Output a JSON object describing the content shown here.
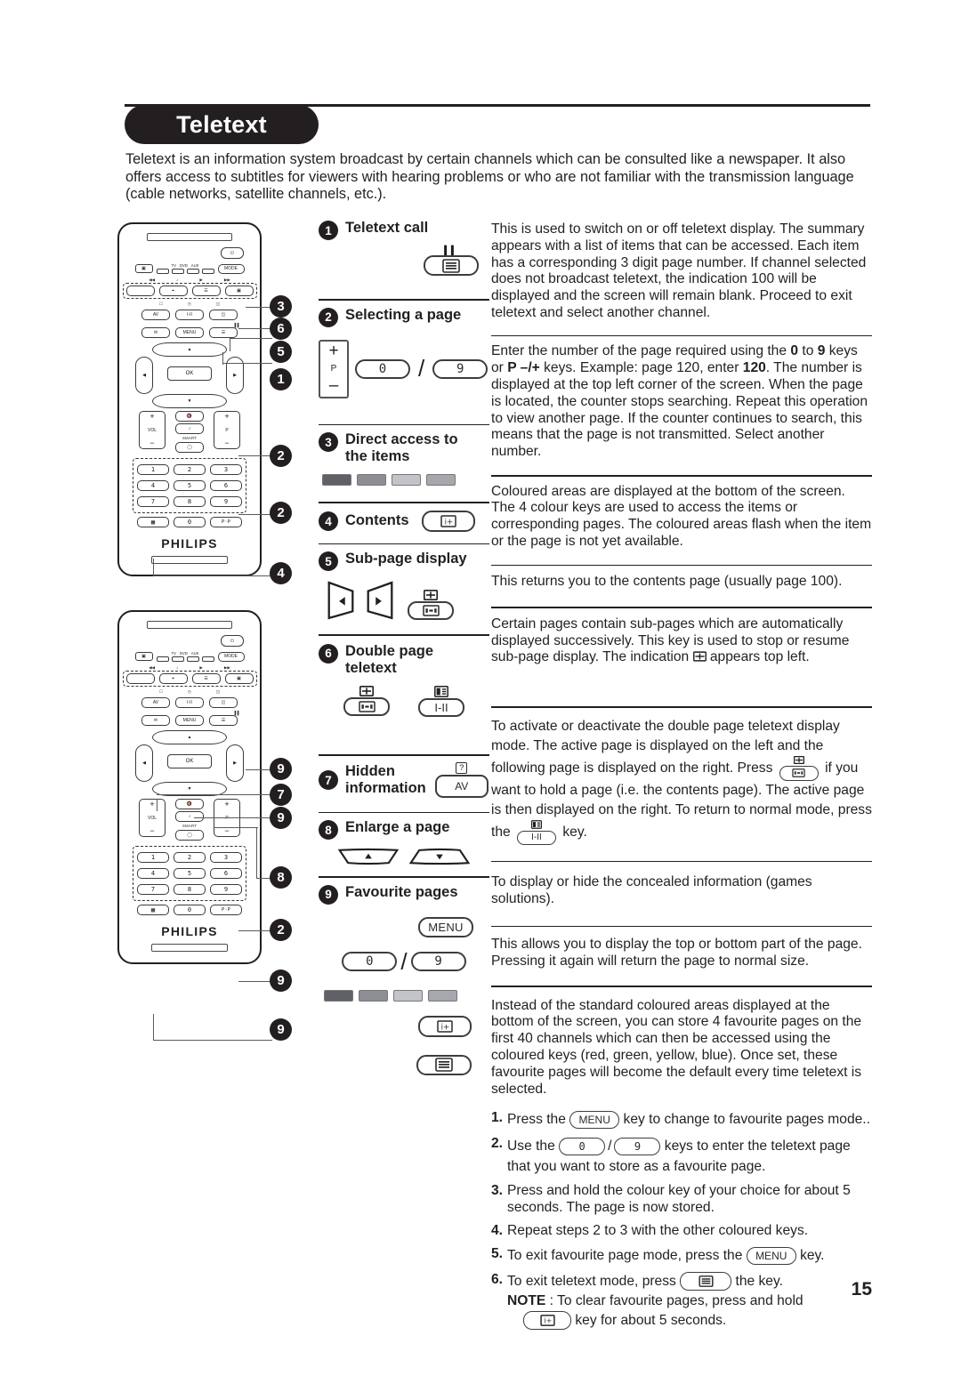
{
  "document": {
    "title": "Teletext",
    "page_number": "15",
    "intro": "Teletext is an information system broadcast by certain channels which can be consulted like a newspaper. It also offers access to subtitles for viewers with hearing problems or who are not familiar with the transmission language (cable networks, satellite channels, etc.)."
  },
  "items": [
    {
      "number": "1",
      "title": "Teletext call",
      "body": "This is used to switch on or off teletext display. The summary appears with a list of items that can be accessed. Each item has a corresponding 3 digit page number. If channel selected does not broadcast teletext, the indication 100 will be displayed and the screen will remain blank. Proceed to exit teletext and select another channel."
    },
    {
      "number": "2",
      "title": "Selecting a page",
      "body": "Enter the number of the page required using the 0 to 9 keys or P –/+ keys. Example: page 120, enter 120. The number is displayed at the top left corner of the screen. When the page is located, the counter stops searching. Repeat this operation to view another page. If the counter continues to search, this means that the page is not transmitted. Select another number."
    },
    {
      "number": "3",
      "title": "Direct access to the items",
      "body": "Coloured areas are displayed at the bottom of the screen. The 4 colour keys are used to access the items or corresponding pages. The coloured areas flash when the item or the page is not yet available."
    },
    {
      "number": "4",
      "title": "Contents",
      "body": "This returns you to the contents page (usually page 100)."
    },
    {
      "number": "5",
      "title": "Sub-page display",
      "body": "Certain pages contain sub-pages which are automatically displayed successively. This key is used to stop or resume sub-page display. The indication  appears top left."
    },
    {
      "number": "6",
      "title": "Double page teletext",
      "body": "To activate or deactivate the double page teletext display mode. The active page is displayed on the left and the following page is displayed on the right. Press  if you want to hold a page (i.e. the contents page). The active page is then displayed on the right. To return to normal mode, press the  key."
    },
    {
      "number": "7",
      "title": "Hidden information",
      "body": "To display or hide the concealed information (games solutions)."
    },
    {
      "number": "8",
      "title": "Enlarge a page",
      "body": "This allows you to display the top or bottom part of the page.  Pressing it again will return the page to normal size."
    },
    {
      "number": "9",
      "title": "Favourite pages",
      "body": "Instead of the standard coloured areas displayed at the bottom of the screen, you can store 4 favourite pages on the first 40 channels which can then be accessed using the coloured keys (red, green, yellow, blue). Once set, these favourite pages will become the default every time teletext is selected."
    }
  ],
  "item_2_text": {
    "part1": "Enter the number of the page required using the ",
    "b1": "0",
    "part2": " to ",
    "b2": "9",
    "part3": " keys or ",
    "b3": "P –/+",
    "part4": " keys. Example: page 120, enter ",
    "b4": "120",
    "part5": ". The number is displayed at the top left corner of the screen. When the page is located, the counter stops searching. Repeat this operation to view another page. If the counter continues to search, this means that the page is not transmitted. Select another number."
  },
  "item_5_text": {
    "part1": "Certain pages contain sub-pages which are automatically displayed successively. This key is used to stop or resume sub-page display. The indication ",
    "part2": " appears top left."
  },
  "item_6_text": {
    "part1": "To activate or deactivate the double page teletext display mode. The active page is displayed on the left and the following page is displayed on the right. Press ",
    "part2": " if you want to hold a page (i.e. the contents page). The active page is then displayed on the right. To return to normal mode, press the ",
    "part3": " key."
  },
  "steps": [
    {
      "num": "1.",
      "pre": "Press the ",
      "chip": "MENU",
      "post": " key to change to favourite pages mode.."
    },
    {
      "num": "2.",
      "pre": "Use the ",
      "chip": "0 / 9",
      "post": " keys to enter the teletext page that you want to store as a favourite page."
    },
    {
      "num": "3.",
      "pre": "Press and hold the colour key of your choice for about 5 seconds. The page is now stored.",
      "chip": "",
      "post": ""
    },
    {
      "num": "4.",
      "pre": "Repeat steps 2 to 3 with the other coloured keys.",
      "chip": "",
      "post": ""
    },
    {
      "num": "5.",
      "pre": "To exit favourite page mode, press the ",
      "chip": "MENU",
      "post": " key."
    },
    {
      "num": "6.",
      "pre": "To exit teletext mode, press ",
      "chip": "teletext",
      "post": " the  key."
    }
  ],
  "note": {
    "label": "NOTE",
    "text": " : To clear favourite pages, press and hold",
    "text2": " key for about 5 seconds."
  },
  "keys": {
    "teletext": "teletext-key",
    "pause": "pause-icon",
    "zero": "0",
    "nine": "9",
    "menu": "MENU",
    "contents": "i+",
    "av": "AV",
    "hidden": "?",
    "i_ii": "I-II",
    "p_plus": "+",
    "p_label": "P",
    "p_minus": "–"
  },
  "remote": {
    "brand": "PHILIPS",
    "mode_buttons": [
      "TV",
      "DVD",
      "AUX"
    ],
    "mode_label": "MODE",
    "transport": [
      "◀◀",
      "♪",
      "▶",
      "▶▶"
    ],
    "row_av": [
      "AV",
      "I-II",
      "▣"
    ],
    "row_menu": [
      "✉",
      "MENU",
      "▤"
    ],
    "ok": "OK",
    "vol": "VOL",
    "prog": "P",
    "smart": "SMART",
    "numbers": [
      "1",
      "2",
      "3",
      "4",
      "5",
      "6",
      "7",
      "8",
      "9",
      "0"
    ],
    "pip": "P·P",
    "callouts_top": [
      "3",
      "6",
      "5",
      "1",
      "2",
      "2",
      "4"
    ],
    "callouts_bottom": [
      "9",
      "7",
      "9",
      "8",
      "2",
      "9",
      "9"
    ]
  },
  "colors": {
    "ink": "#231f20",
    "bar1": "#5f6166",
    "bar2": "#8c8e94",
    "bar3": "#c3c4c9",
    "bar4": "#a6a8ae",
    "line": "#5a5a5a"
  }
}
